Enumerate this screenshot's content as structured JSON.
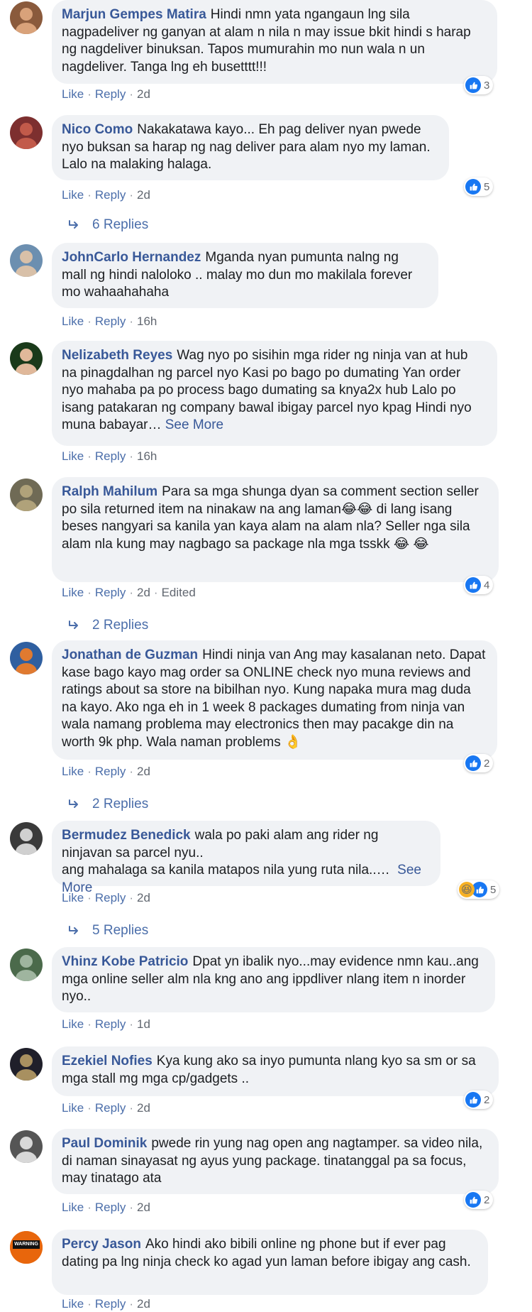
{
  "comments": [
    {
      "author": "Marjun Gempes Matira",
      "text": "Hindi nmn yata ngangaun lng sila nagpadeliver ng ganyan at alam n nila n may issue bkit hindi s harap ng nagdeliver binuksan. Tapos mumurahin mo nun wala n un nagdeliver. Tanga lng eh busetttt!!!",
      "like_label": "Like",
      "reply_label": "Reply",
      "time": "2d",
      "reactions": "3",
      "avatar_icon": "user-avatar-icon"
    },
    {
      "author": "Nico Como",
      "text": "Nakakatawa kayo... Eh pag deliver nyan pwede nyo buksan sa harap ng nag deliver para alam nyo my laman. Lalo na malaking halaga.",
      "like_label": "Like",
      "reply_label": "Reply",
      "time": "2d",
      "reactions": "5",
      "replies": "6 Replies"
    },
    {
      "author": "JohnCarlo Hernandez",
      "text": "Mganda nyan pumunta nalng ng mall ng hindi naloloko .. malay mo dun mo makilala forever mo wahaahahaha",
      "like_label": "Like",
      "reply_label": "Reply",
      "time": "16h"
    },
    {
      "author": "Nelizabeth Reyes",
      "text": "Wag nyo po sisihin mga rider ng ninja van at hub na pinagdalhan ng parcel nyo Kasi po bago po dumating Yan order nyo mahaba pa po process bago dumating sa knya2x hub Lalo po isang patakaran ng company bawal ibigay parcel nyo kpag Hindi nyo muna babayar…",
      "see_more": "See More",
      "like_label": "Like",
      "reply_label": "Reply",
      "time": "16h"
    },
    {
      "author": "Ralph Mahilum",
      "text": "Para sa mga shunga dyan sa comment section seller po sila returned item na ninakaw na ang laman😂😂 di lang isang beses nangyari sa kanila yan kaya alam na alam nla? Seller nga sila alam nla kung may nagbago sa package nla mga tsskk 😂 😂",
      "like_label": "Like",
      "reply_label": "Reply",
      "time": "2d",
      "edited": "Edited",
      "reactions": "4",
      "replies": "2 Replies"
    },
    {
      "author": "Jonathan de Guzman",
      "text": "Hindi ninja van Ang may kasalanan neto. Dapat kase bago kayo mag order sa ONLINE check nyo muna reviews and ratings about sa store na bibilhan nyo. Kung napaka mura mag duda na kayo. Ako nga eh in 1 week 8 packages dumating from ninja van wala namang problema may electronics then may pacakge din na worth 9k php. Wala naman problems 👌",
      "like_label": "Like",
      "reply_label": "Reply",
      "time": "2d",
      "reactions": "2",
      "replies": "2 Replies"
    },
    {
      "author": "Bermudez Benedick",
      "text": "wala po paki alam ang rider ng ninjavan sa parcel nyu..\nang mahalaga sa kanila matapos nila yung ruta nila..… ",
      "see_more": "See More",
      "like_label": "Like",
      "reply_label": "Reply",
      "time": "2d",
      "reactions": "5",
      "replies": "5 Replies"
    },
    {
      "author": "Vhinz Kobe Patricio",
      "text": "Dpat yn ibalik nyo...may evidence nmn kau..ang mga online seller alm nla kng ano ang ippdliver nlang item n inorder nyo..",
      "like_label": "Like",
      "reply_label": "Reply",
      "time": "1d"
    },
    {
      "author": "Ezekiel Nofies",
      "text": "Kya kung ako sa inyo pumunta nlang kyo sa sm or sa mga stall mg mga cp/gadgets ..",
      "like_label": "Like",
      "reply_label": "Reply",
      "time": "2d",
      "reactions": "2"
    },
    {
      "author": "Paul Dominik",
      "text": "pwede rin yung nag open ang nagtamper. sa video nila, di naman sinayasat ng ayus yung package. tinatanggal pa sa focus, may tinatago ata",
      "like_label": "Like",
      "reply_label": "Reply",
      "time": "2d",
      "reactions": "2"
    },
    {
      "author": "Percy Jason",
      "text": "Ako hindi ako bibili online ng phone but if ever pag dating pa lng ninja check ko agad yun laman before ibigay ang cash.",
      "like_label": "Like",
      "reply_label": "Reply",
      "time": "2d",
      "avatar_badge": "WARNING"
    }
  ],
  "colors": {
    "link": "#385898",
    "bubble": "#f0f2f5",
    "like_blue": "#1877f2"
  }
}
